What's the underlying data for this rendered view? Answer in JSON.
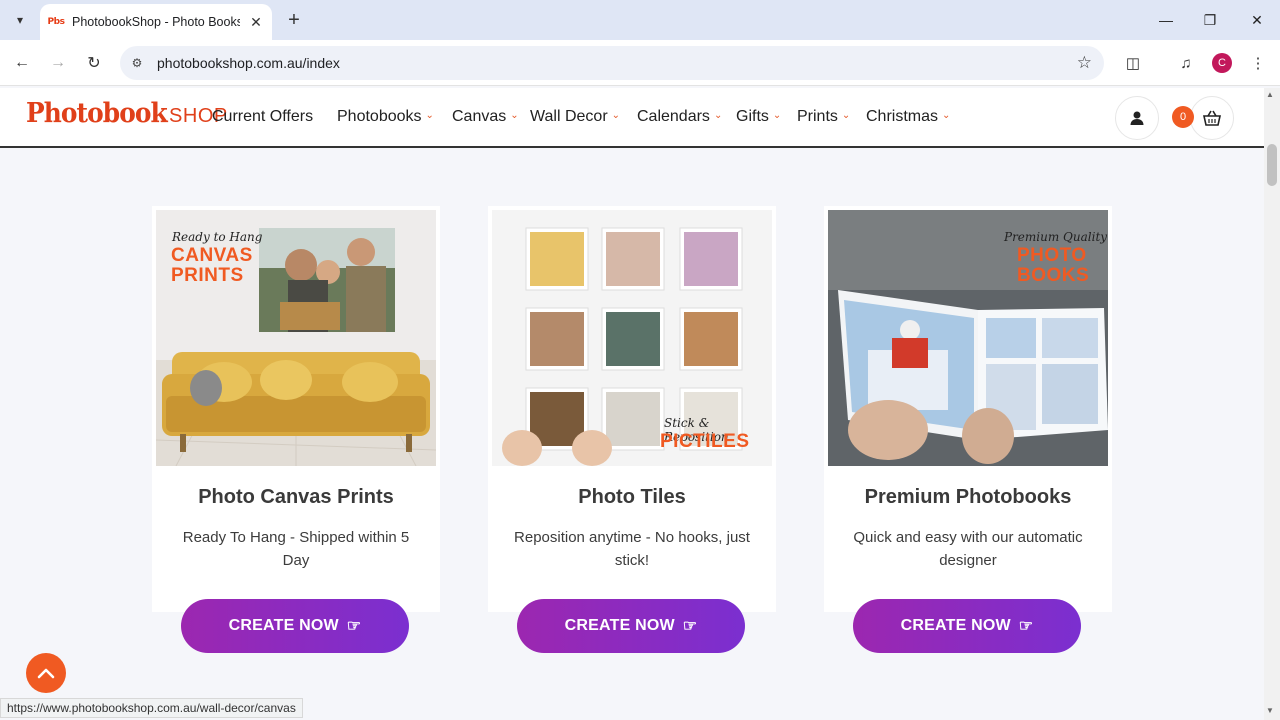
{
  "browser": {
    "tab_title": "PhotobookShop - Photo Books",
    "tab_favicon_text": "Pbs",
    "url": "photobookshop.com.au/index",
    "profile_initial": "C",
    "status_url": "https://www.photobookshop.com.au/wall-decor/canvas"
  },
  "site": {
    "logo_main": "Photobook",
    "logo_shop": "SHOP",
    "nav": [
      {
        "label": "Current Offers",
        "has_dropdown": false
      },
      {
        "label": "Photobooks",
        "has_dropdown": true
      },
      {
        "label": "Canvas",
        "has_dropdown": true
      },
      {
        "label": "Wall Decor",
        "has_dropdown": true
      },
      {
        "label": "Calendars",
        "has_dropdown": true
      },
      {
        "label": "Gifts",
        "has_dropdown": true
      },
      {
        "label": "Prints",
        "has_dropdown": true
      },
      {
        "label": "Christmas",
        "has_dropdown": true
      }
    ],
    "cart_count": "0",
    "accent_color": "#f05a22",
    "button_color": "#8e2bc4"
  },
  "products": [
    {
      "title": "Photo Canvas Prints",
      "description": "Ready To Hang - Shipped within 5 Day",
      "button": "CREATE NOW",
      "image_script": "Ready to Hang",
      "image_headline_1": "CANVAS",
      "image_headline_2": "PRINTS"
    },
    {
      "title": "Photo Tiles",
      "description": "Reposition anytime - No hooks, just stick!",
      "button": "CREATE NOW",
      "image_script": "Stick & Reposition",
      "image_headline_1": "PICTILES"
    },
    {
      "title": "Premium Photobooks",
      "description": "Quick and easy with our automatic designer",
      "button": "CREATE NOW",
      "image_script": "Premium Quality",
      "image_headline_1": "PHOTO",
      "image_headline_2": "BOOKS"
    }
  ]
}
